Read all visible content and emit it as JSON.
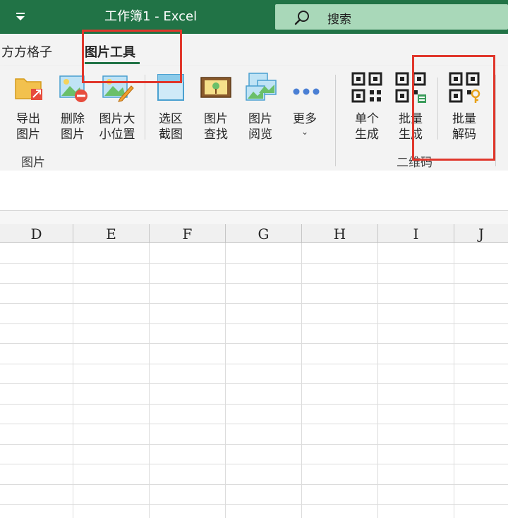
{
  "titlebar": {
    "title": "工作簿1  -  Excel",
    "search_label": "搜索",
    "qat_icon": "customize-qat-icon"
  },
  "tabs": [
    {
      "label": "方方格子",
      "active": false
    },
    {
      "label": "图片工具",
      "active": true
    }
  ],
  "ribbon": {
    "buttons": [
      {
        "id": "export",
        "icon": "export-image-icon",
        "line1": "导出",
        "line2": "图片"
      },
      {
        "id": "delete",
        "icon": "delete-image-icon",
        "line1": "删除",
        "line2": "图片"
      },
      {
        "id": "resize",
        "icon": "image-size-position-icon",
        "line1": "图片大",
        "line2": "小位置"
      },
      {
        "id": "crop",
        "icon": "region-screenshot-icon",
        "line1": "选区",
        "line2": "截图"
      },
      {
        "id": "find",
        "icon": "find-image-icon",
        "line1": "图片",
        "line2": "查找"
      },
      {
        "id": "browse",
        "icon": "browse-images-icon",
        "line1": "图片",
        "line2": "阅览"
      },
      {
        "id": "more",
        "icon": "more-dots-icon",
        "line1": "更多",
        "line2": "⌄"
      },
      {
        "id": "qr-single",
        "icon": "qr-code-icon",
        "line1": "单个",
        "line2": "生成"
      },
      {
        "id": "qr-batch",
        "icon": "qr-batch-icon",
        "line1": "批量",
        "line2": "生成"
      },
      {
        "id": "qr-decode",
        "icon": "qr-decode-icon",
        "line1": "批量",
        "line2": "解码"
      }
    ],
    "groups": {
      "images": "图片",
      "qrcode": "二维码"
    },
    "stub": "\u0010"
  },
  "sheet": {
    "columns": [
      "D",
      "E",
      "F",
      "G",
      "H",
      "I",
      "J"
    ]
  },
  "colors": {
    "title_green": "#217346",
    "search_bg": "#a9d8b9",
    "annotation_red": "#e0372c"
  }
}
